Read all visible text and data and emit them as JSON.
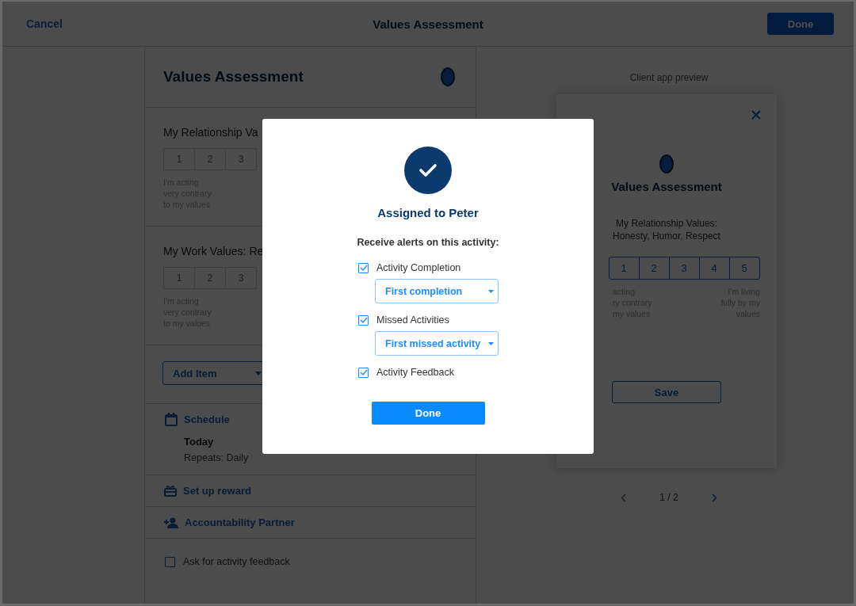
{
  "top_bar": {
    "cancel": "Cancel",
    "title": "Values Assessment",
    "done": "Done"
  },
  "editor": {
    "title": "Values Assessment",
    "questions": [
      {
        "title": "My Relationship Va",
        "options": [
          "1",
          "2",
          "3"
        ],
        "low_label": [
          "I'm acting",
          "very contrary",
          "to my values"
        ]
      },
      {
        "title": "My Work Values: Re",
        "options": [
          "1",
          "2",
          "3"
        ],
        "low_label": [
          "I'm acting",
          "very contrary",
          "to my values"
        ]
      }
    ],
    "add_item": "Add Item",
    "schedule": {
      "label": "Schedule",
      "start": "Today",
      "repeat": "Repeats: Daily"
    },
    "links": [
      {
        "kind": "reward",
        "label": "Set up reward"
      },
      {
        "kind": "partner",
        "label": "Accountability Partner"
      }
    ],
    "feedback_option": {
      "label": "Ask for activity feedback",
      "checked": false
    }
  },
  "preview": {
    "caption": "Client app preview",
    "title": "Values Assessment",
    "question": [
      "My Relationship Values:",
      "Honesty, Humor, Respect"
    ],
    "options": [
      "1",
      "2",
      "3",
      "4",
      "5"
    ],
    "low_label": [
      "acting",
      "ry contrary",
      "my values"
    ],
    "high_label": [
      "I'm living",
      "fully by my",
      "values"
    ],
    "save": "Save",
    "page": "1 / 2"
  },
  "modal": {
    "title": "Assigned to Peter",
    "prompt": "Receive alerts on this activity:",
    "alerts": [
      {
        "label": "Activity Completion",
        "checked": true,
        "dropdown": "First completion"
      },
      {
        "label": "Missed Activities",
        "checked": true,
        "dropdown": "First missed activity"
      },
      {
        "label": "Activity Feedback",
        "checked": true
      }
    ],
    "done": "Done"
  }
}
